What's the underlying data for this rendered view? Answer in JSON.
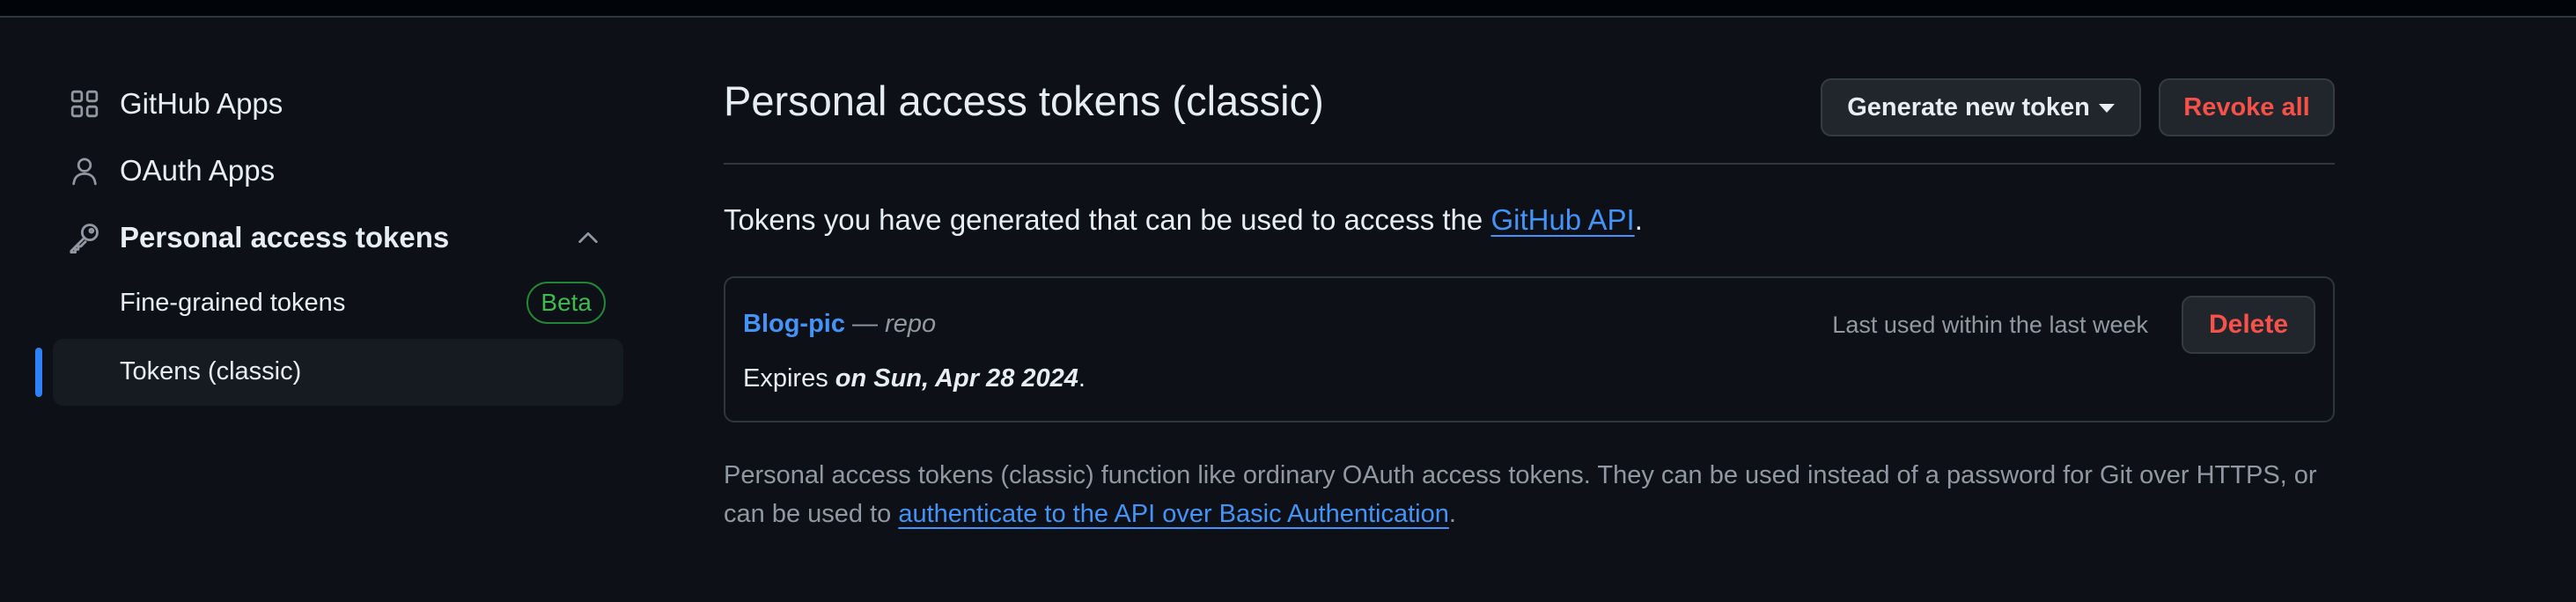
{
  "sidebar": {
    "items": [
      {
        "label": "GitHub Apps",
        "icon": "apps-grid-icon"
      },
      {
        "label": "OAuth Apps",
        "icon": "person-icon"
      },
      {
        "label": "Personal access tokens",
        "icon": "key-icon",
        "expanded": true
      }
    ],
    "subitems": [
      {
        "label": "Fine-grained tokens",
        "badge": "Beta"
      },
      {
        "label": "Tokens (classic)",
        "selected": true
      }
    ]
  },
  "main": {
    "title": "Personal access tokens (classic)",
    "generate_label": "Generate new token",
    "revoke_label": "Revoke all",
    "intro_prefix": "Tokens you have generated that can be used to access the ",
    "intro_link": "GitHub API",
    "intro_suffix": ".",
    "token": {
      "name": "Blog-pic",
      "separator": " — ",
      "scope": "repo",
      "last_used": "Last used within the last week",
      "delete_label": "Delete",
      "expires_prefix": "Expires ",
      "expires_date": "on Sun, Apr 28 2024",
      "expires_suffix": "."
    },
    "note_prefix": "Personal access tokens (classic) function like ordinary OAuth access tokens. They can be used instead of a password for Git over HTTPS, or can be used to ",
    "note_link": "authenticate to the API over Basic Authentication",
    "note_suffix": "."
  },
  "colors": {
    "background": "#0d1117",
    "accent": "#2f81f7",
    "link": "#4493f8",
    "danger": "#f85149",
    "success": "#3fb950"
  }
}
